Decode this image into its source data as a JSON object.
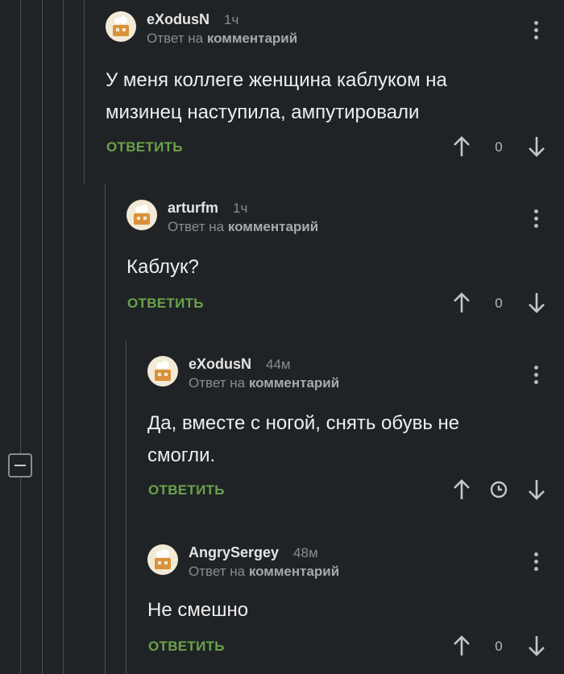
{
  "ui": {
    "reply_word": "Ответ на",
    "reply_target": "комментарий"
  },
  "comments": [
    {
      "author": "eXodusN",
      "time": "1ч",
      "text": "У меня коллеге женщина каблуком на мизинец наступила, ампутировали",
      "reply_label": "ОТВЕТИТЬ",
      "score": "0"
    },
    {
      "author": "arturfm",
      "time": "1ч",
      "text": "Каблук?",
      "reply_label": "ОТВЕТИТЬ",
      "score": "0"
    },
    {
      "author": "eXodusN",
      "time": "44м",
      "text": "Да, вместе с ногой, снять обувь не смогли.",
      "reply_label": "ОТВЕТИТЬ",
      "score_icon": "clock-icon"
    },
    {
      "author": "AngrySergey",
      "time": "48м",
      "text": "Не смешно",
      "reply_label": "ОТВЕТИТЬ",
      "score": "0"
    }
  ]
}
